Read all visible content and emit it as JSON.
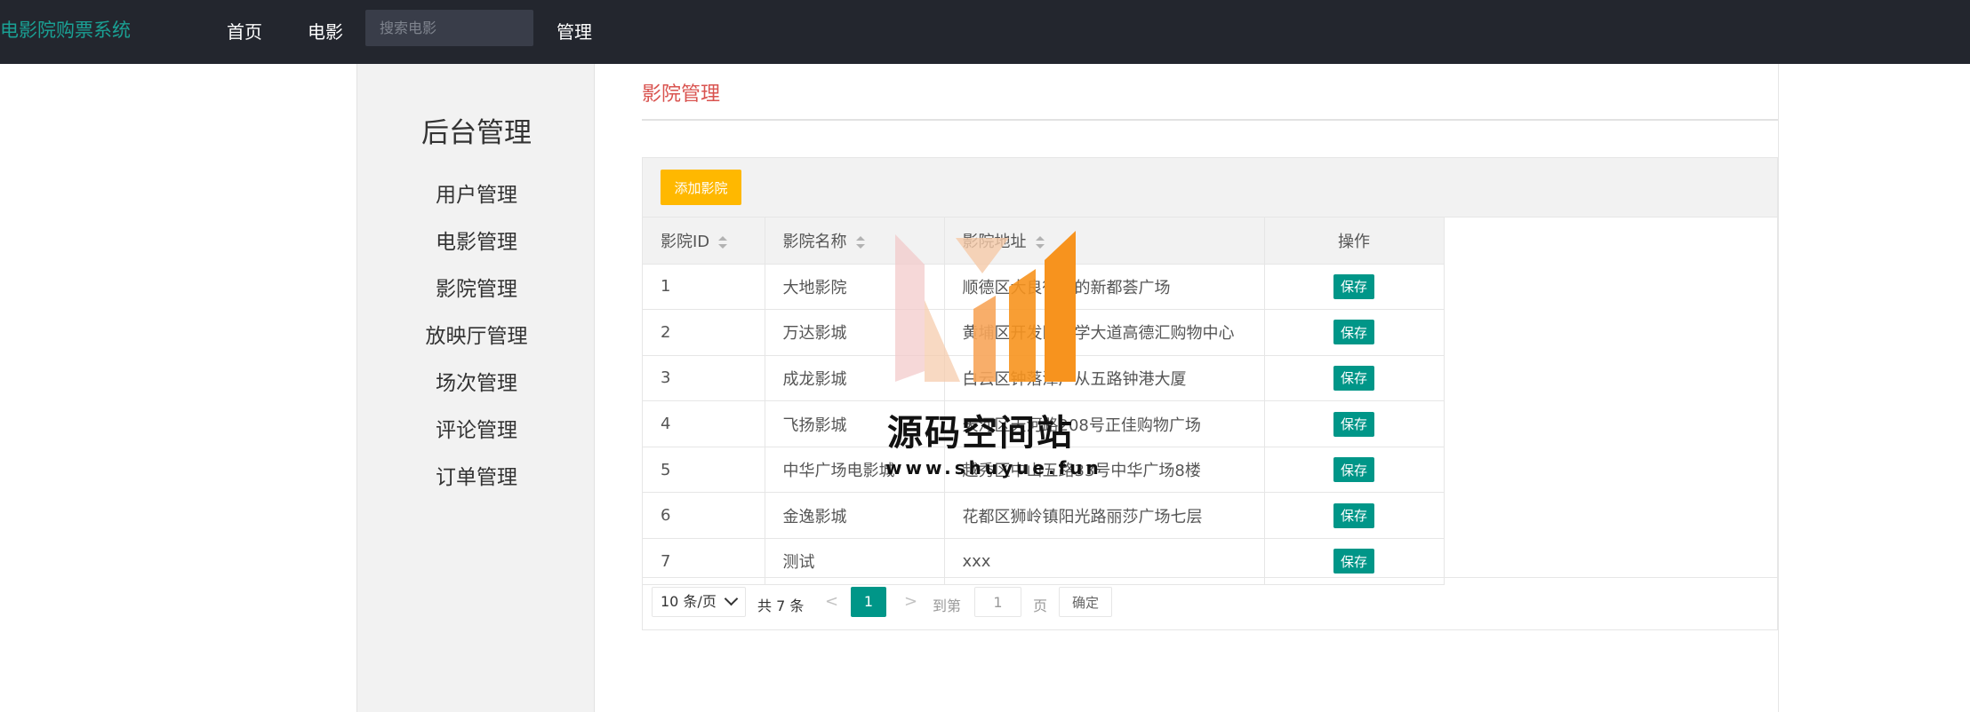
{
  "header": {
    "brand": "电影院购票系统",
    "nav_home": "首页",
    "nav_movie": "电影",
    "search_placeholder": "搜索电影",
    "nav_admin": "管理"
  },
  "sidebar": {
    "title": "后台管理",
    "items": [
      {
        "label": "用户管理"
      },
      {
        "label": "电影管理"
      },
      {
        "label": "影院管理"
      },
      {
        "label": "放映厅管理"
      },
      {
        "label": "场次管理"
      },
      {
        "label": "评论管理"
      },
      {
        "label": "订单管理"
      }
    ]
  },
  "main": {
    "page_title": "影院管理",
    "add_button": "添加影院",
    "columns": {
      "id": "影院ID",
      "name": "影院名称",
      "address": "影院地址",
      "action": "操作"
    },
    "rows": [
      {
        "id": "1",
        "name": "大地影院",
        "address": "顺德区大良街道的新都荟广场",
        "action": "保存"
      },
      {
        "id": "2",
        "name": "万达影城",
        "address": "黄埔区开发区科学大道高德汇购物中心",
        "action": "保存"
      },
      {
        "id": "3",
        "name": "成龙影城",
        "address": "白云区钟落潭广从五路钟港大厦",
        "action": "保存"
      },
      {
        "id": "4",
        "name": "飞扬影城",
        "address": "天河区天河路208号正佳购物广场",
        "action": "保存"
      },
      {
        "id": "5",
        "name": "中华广场电影城",
        "address": "越秀区中山五路33号中华广场8楼",
        "action": "保存"
      },
      {
        "id": "6",
        "name": "金逸影城",
        "address": "花都区狮岭镇阳光路丽莎广场七层",
        "action": "保存"
      },
      {
        "id": "7",
        "name": "测试",
        "address": "xxx",
        "action": "保存"
      }
    ]
  },
  "pager": {
    "page_size": "10 条/页",
    "total": "共 7 条",
    "prev": "<",
    "current": "1",
    "next": ">",
    "goto_label": "到第",
    "goto_value": "1",
    "page_label": "页",
    "confirm": "确定"
  },
  "watermark": {
    "text": "源码空间站",
    "url": "www.shuyue.fun"
  },
  "colors": {
    "topbar": "#23262e",
    "brand": "#1aa094",
    "accent_green": "#009688",
    "add_button": "#ffb800",
    "page_title": "#d9534f"
  }
}
